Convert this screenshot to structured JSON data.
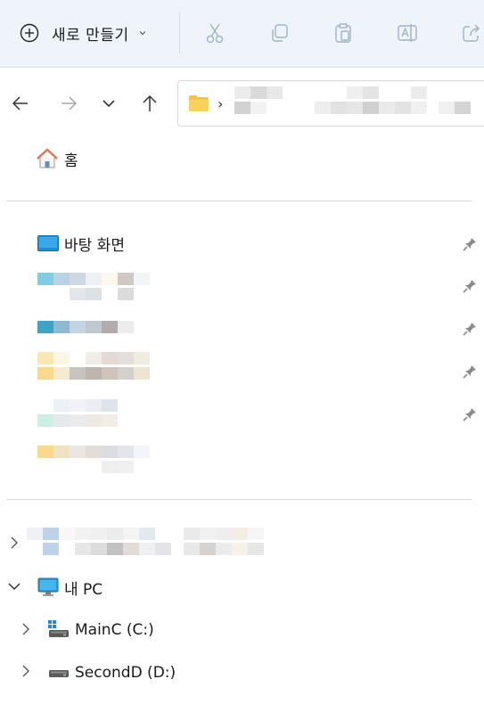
{
  "toolbar": {
    "new_label": "새로 만들기",
    "icons": [
      "plus-circle-icon",
      "chevron-down-icon",
      "cut-icon",
      "copy-icon",
      "paste-icon",
      "rename-icon",
      "share-icon"
    ]
  },
  "nav": {
    "icons": [
      "back-arrow-icon",
      "forward-arrow-icon",
      "recent-dropdown-icon",
      "up-arrow-icon"
    ]
  },
  "address": {
    "separator": "›"
  },
  "sidebar": {
    "home_label": "홈",
    "desktop_label": "바탕 화면",
    "this_pc_label": "내 PC",
    "drives": [
      {
        "label": "MainC (C:)"
      },
      {
        "label": "SecondD (D:)"
      }
    ]
  },
  "colors": {
    "command_bar_bg": "#eef4f9",
    "accent_blue": "#1e7bd6",
    "folder_yellow": "#f6c443",
    "icon_gray": "#9fb3c4"
  }
}
